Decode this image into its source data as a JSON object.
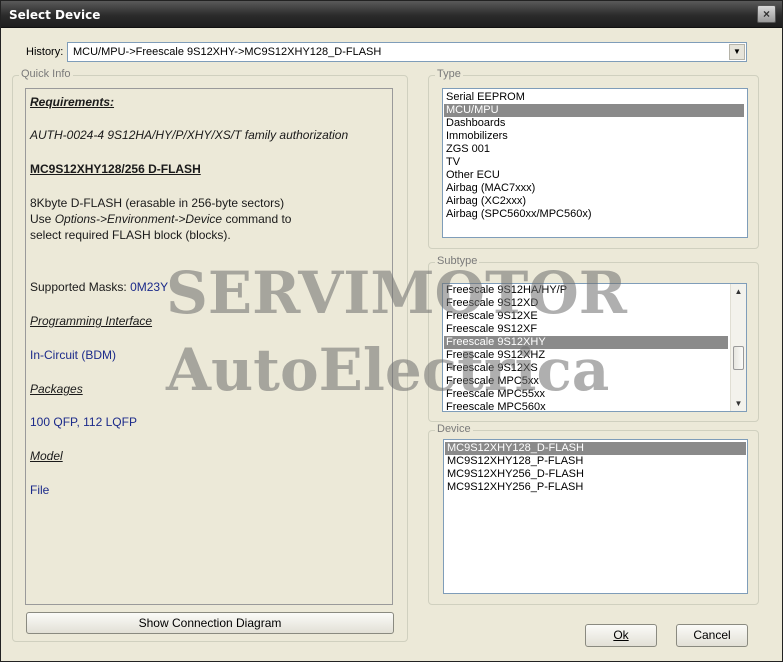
{
  "window": {
    "title": "Select Device",
    "close_glyph": "×"
  },
  "history": {
    "label": "History:",
    "value": "MCU/MPU->Freescale 9S12XHY->MC9S12XHY128_D-FLASH",
    "arrow": "▼"
  },
  "quick_info": {
    "group_label": "Quick Info",
    "requirements_heading": "Requirements:",
    "auth_line": "AUTH-0024-4  9S12HA/HY/P/XHY/XS/T family authorization",
    "device_heading": "MC9S12XHY128/256 D-FLASH",
    "desc_line1": "8Kbyte D-FLASH (erasable in 256-byte sectors)",
    "desc_line2_prefix": "Use ",
    "desc_line2_opt1": "Options->Environment->Device",
    "desc_line2_suffix": " command to",
    "desc_line3": "select required FLASH block (blocks).",
    "masks_label": "Supported Masks: ",
    "masks_value": "0M23Y",
    "prog_heading": "Programming Interface",
    "prog_value": "In-Circuit (BDM)",
    "packages_heading": "Packages",
    "packages_value": "100 QFP, 112 LQFP",
    "model_heading": "Model",
    "model_value": "File",
    "diagram_button": "Show Connection Diagram"
  },
  "type": {
    "group_label": "Type",
    "items": [
      "Serial EEPROM",
      "MCU/MPU",
      "Dashboards",
      "Immobilizers",
      "ZGS 001",
      "TV",
      "Other ECU",
      "Airbag (MAC7xxx)",
      "Airbag (XC2xxx)",
      "Airbag (SPC560xx/MPC560x)"
    ],
    "selected_index": 1
  },
  "subtype": {
    "group_label": "Subtype",
    "items": [
      "Freescale 9S12HA/HY/P",
      "Freescale 9S12XD",
      "Freescale 9S12XE",
      "Freescale 9S12XF",
      "Freescale 9S12XHY",
      "Freescale 9S12XHZ",
      "Freescale 9S12XS",
      "Freescale MPC5xx",
      "Freescale MPC55xx",
      "Freescale MPC560x"
    ],
    "selected_index": 4,
    "scroll_up": "▲",
    "scroll_down": "▼",
    "scroll_position": 0.62
  },
  "device": {
    "group_label": "Device",
    "items": [
      "MC9S12XHY128_D-FLASH",
      "MC9S12XHY128_P-FLASH",
      "MC9S12XHY256_D-FLASH",
      "MC9S12XHY256_P-FLASH"
    ],
    "selected_index": 0
  },
  "buttons": {
    "ok": "Ok",
    "cancel": "Cancel"
  },
  "watermark": {
    "line1": "SERVIMOTOR",
    "line2": "AutoElectrica"
  },
  "colors": {
    "selection": "#8a8a8a",
    "info_value": "#1b2a8a"
  }
}
